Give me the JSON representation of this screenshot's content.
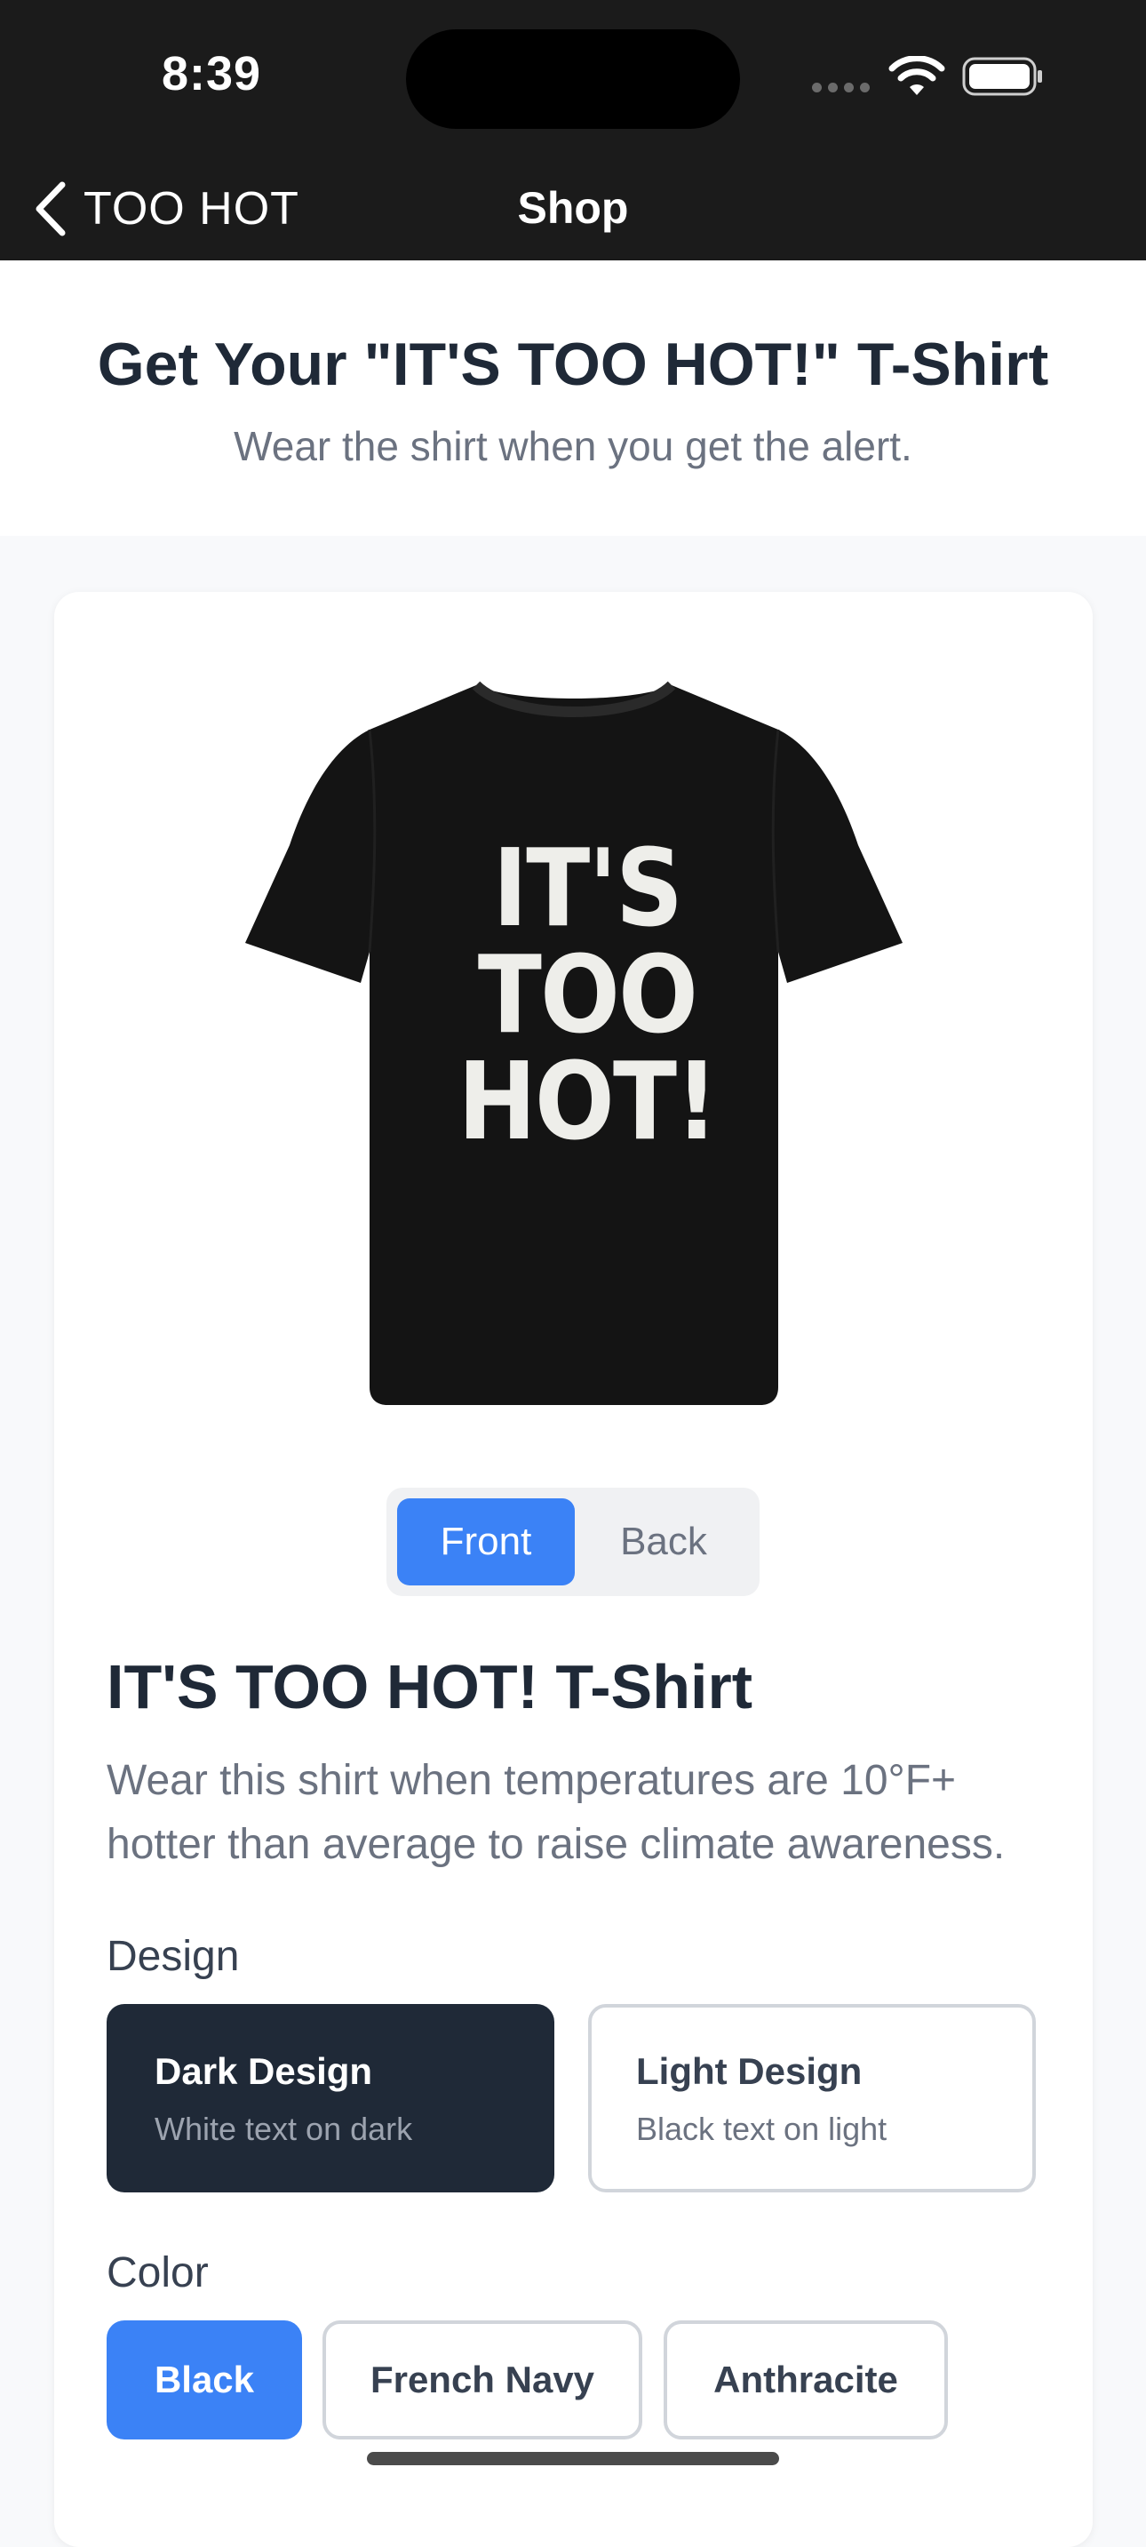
{
  "status_bar": {
    "time": "8:39"
  },
  "nav": {
    "back_label": "TOO HOT",
    "title": "Shop"
  },
  "header": {
    "title": "Get Your \"IT'S TOO HOT!\" T-Shirt",
    "subtitle": "Wear the shirt when you get the alert."
  },
  "product": {
    "shirt_print": [
      "IT'S",
      "TOO",
      "HOT!"
    ],
    "view_toggle": {
      "front": "Front",
      "back": "Back",
      "selected": "Front"
    },
    "name": "IT'S TOO HOT! T-Shirt",
    "description": "Wear this shirt when temperatures are 10°F+ hotter than average to raise climate awareness.",
    "design": {
      "label": "Design",
      "options": [
        {
          "title": "Dark Design",
          "subtitle": "White text on dark",
          "selected": true
        },
        {
          "title": "Light Design",
          "subtitle": "Black text on light",
          "selected": false
        }
      ]
    },
    "color": {
      "label": "Color",
      "options": [
        "Black",
        "French Navy",
        "Anthracite"
      ],
      "selected": "Black"
    }
  },
  "colors": {
    "accent": "#3b82f6",
    "dark": "#1f2937",
    "nav_bg": "#1b1b1b"
  }
}
